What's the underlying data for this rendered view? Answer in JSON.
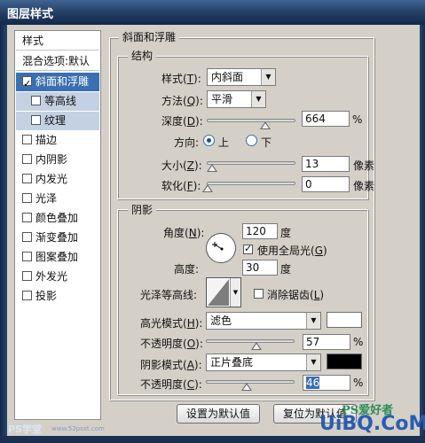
{
  "window": {
    "title": "图层样式"
  },
  "sidebar": {
    "header": "样式",
    "blend": "混合选项:默认",
    "items": [
      {
        "label": "斜面和浮雕",
        "checked": true,
        "selected": true
      },
      {
        "label": "等高线",
        "checked": false,
        "sub": true
      },
      {
        "label": "纹理",
        "checked": false,
        "sub": true
      },
      {
        "label": "描边",
        "checked": false
      },
      {
        "label": "内阴影",
        "checked": false
      },
      {
        "label": "内发光",
        "checked": false
      },
      {
        "label": "光泽",
        "checked": false
      },
      {
        "label": "颜色叠加",
        "checked": false
      },
      {
        "label": "渐变叠加",
        "checked": false
      },
      {
        "label": "图案叠加",
        "checked": false
      },
      {
        "label": "外发光",
        "checked": false
      },
      {
        "label": "投影",
        "checked": false
      }
    ]
  },
  "bevel": {
    "title": "斜面和浮雕",
    "structure": {
      "title": "结构",
      "style": {
        "label": "样式",
        "key": "T",
        "value": "内斜面"
      },
      "technique": {
        "label": "方法",
        "key": "Q",
        "value": "平滑"
      },
      "depth": {
        "label": "深度",
        "key": "D",
        "value": "664",
        "unit": "%",
        "level": 0.66
      },
      "direction": {
        "label": "方向:",
        "up": "上",
        "down": "下",
        "selected": "up"
      },
      "size": {
        "label": "大小",
        "key": "Z",
        "value": "13",
        "unit": "像素",
        "level": 0.05
      },
      "soften": {
        "label": "软化",
        "key": "F",
        "value": "0",
        "unit": "像素",
        "level": 0
      }
    },
    "shading": {
      "title": "阴影",
      "angle": {
        "label": "角度",
        "key": "N",
        "value": "120",
        "unit": "度"
      },
      "global_light": {
        "label": "使用全局光",
        "key": "G",
        "checked": true
      },
      "altitude": {
        "label": "高度:",
        "value": "30",
        "unit": "度"
      },
      "gloss_contour": {
        "label": "光泽等高线:"
      },
      "anti_alias": {
        "label": "消除锯齿",
        "key": "L",
        "checked": false
      },
      "highlight_mode": {
        "label": "高光模式",
        "key": "H",
        "value": "滤色",
        "color": "#ffffff"
      },
      "highlight_opacity": {
        "label": "不透明度",
        "key": "O",
        "value": "57",
        "unit": "%",
        "level": 0.57
      },
      "shadow_mode": {
        "label": "阴影模式",
        "key": "A",
        "value": "正片叠底",
        "color": "#000000"
      },
      "shadow_opacity": {
        "label": "不透明度",
        "key": "C",
        "value": "46",
        "unit": "%",
        "level": 0.46
      }
    },
    "buttons": {
      "make_default": "设置为默认值",
      "reset_default": "复位为默认值"
    }
  },
  "watermarks": {
    "left": "PS学堂",
    "left_url": "www.52psxt.com",
    "right_top": "PS爱好者",
    "right": "UiBQ.CoM"
  },
  "colors": {
    "accent": "#3a6fb2",
    "title_bar": "#203d63",
    "dialog_bg": "#d4d0c8"
  }
}
